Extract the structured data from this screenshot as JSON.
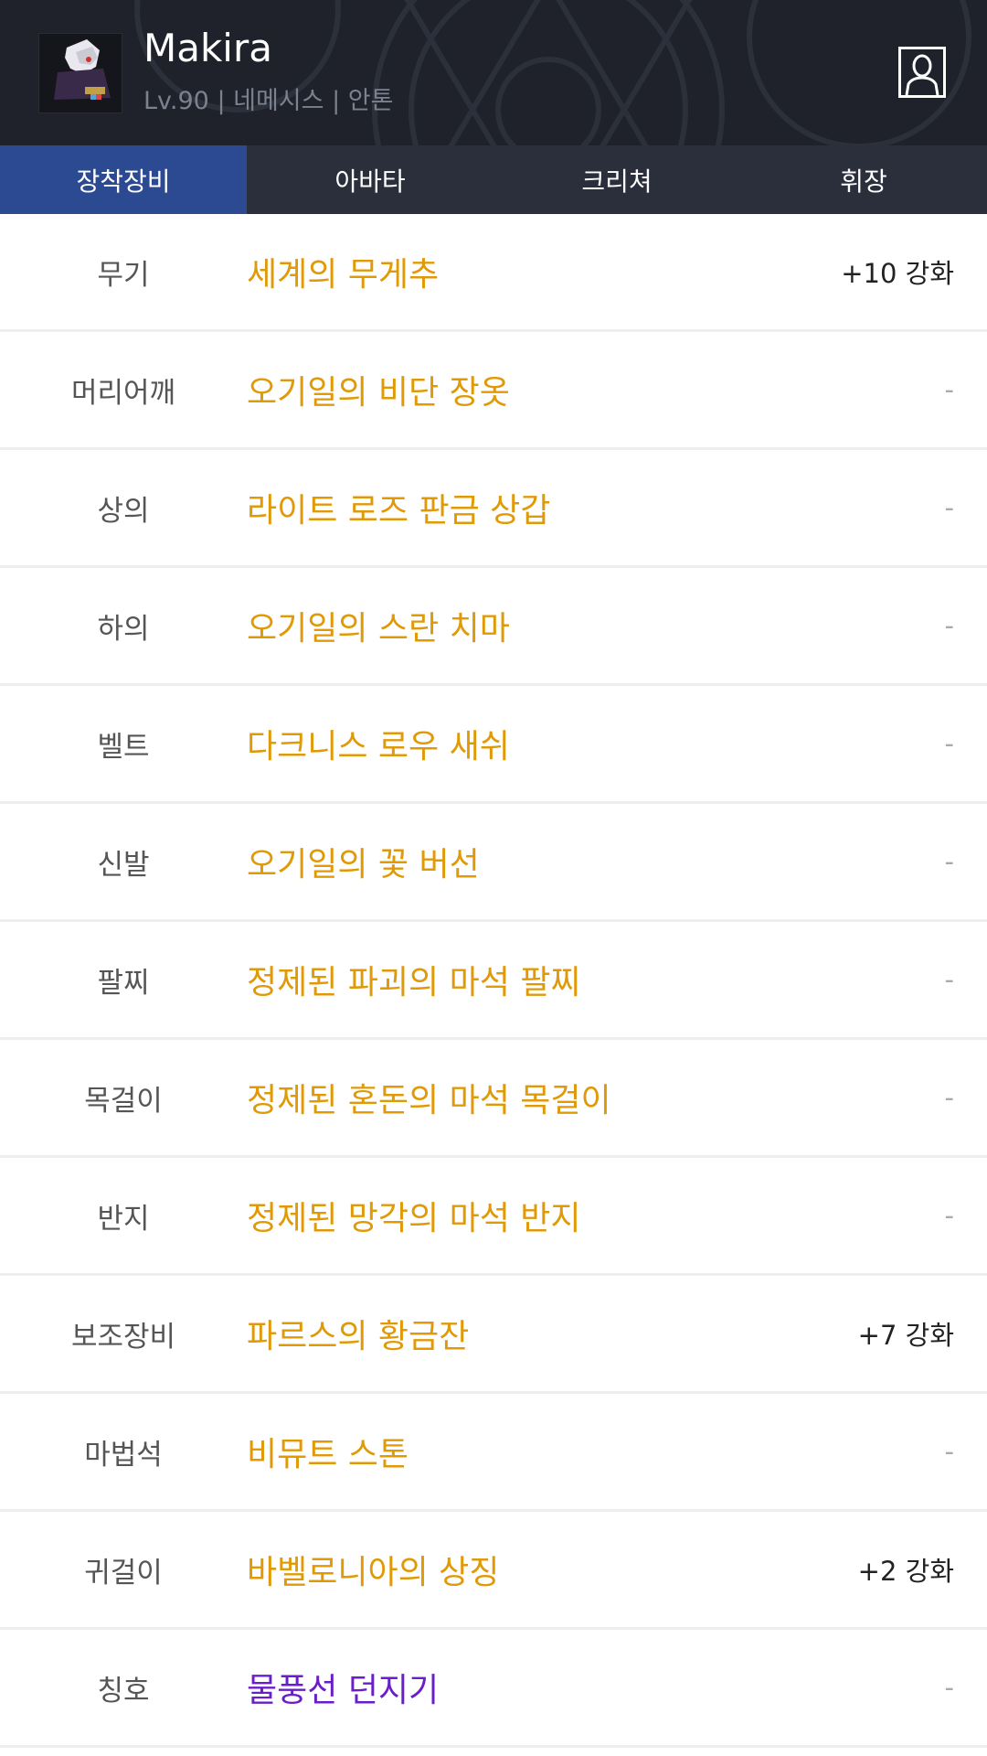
{
  "character": {
    "name": "Makira",
    "info": "Lv.90 | 네메시스 | 안톤"
  },
  "tabs": [
    "장착장비",
    "아바타",
    "크리쳐",
    "휘장"
  ],
  "colors": {
    "header_bg": "#1f222b",
    "tab_bg": "#2b2f3b",
    "tab_active": "#2c4a92",
    "item_epic": "#e09a08",
    "item_title": "#6a1ec8"
  },
  "equipment": [
    {
      "slot": "무기",
      "item": "세계의 무게추",
      "value": "+10 강화",
      "color": "#e09a08"
    },
    {
      "slot": "머리어깨",
      "item": "오기일의 비단 장옷",
      "value": "-",
      "color": "#e09a08"
    },
    {
      "slot": "상의",
      "item": "라이트 로즈 판금 상갑",
      "value": "-",
      "color": "#e09a08"
    },
    {
      "slot": "하의",
      "item": "오기일의 스란 치마",
      "value": "-",
      "color": "#e09a08"
    },
    {
      "slot": "벨트",
      "item": "다크니스 로우 새쉬",
      "value": "-",
      "color": "#e09a08"
    },
    {
      "slot": "신발",
      "item": "오기일의 꽃 버선",
      "value": "-",
      "color": "#e09a08"
    },
    {
      "slot": "팔찌",
      "item": "정제된 파괴의 마석 팔찌",
      "value": "-",
      "color": "#e09a08"
    },
    {
      "slot": "목걸이",
      "item": "정제된 혼돈의 마석 목걸이",
      "value": "-",
      "color": "#e09a08"
    },
    {
      "slot": "반지",
      "item": "정제된 망각의 마석 반지",
      "value": "-",
      "color": "#e09a08"
    },
    {
      "slot": "보조장비",
      "item": "파르스의 황금잔",
      "value": "+7 강화",
      "color": "#e09a08"
    },
    {
      "slot": "마법석",
      "item": "비뮤트 스톤",
      "value": "-",
      "color": "#e09a08"
    },
    {
      "slot": "귀걸이",
      "item": "바벨로니아의 상징",
      "value": "+2 강화",
      "color": "#e09a08"
    },
    {
      "slot": "칭호",
      "item": "물풍선 던지기",
      "value": "-",
      "color": "#6a1ec8"
    }
  ]
}
